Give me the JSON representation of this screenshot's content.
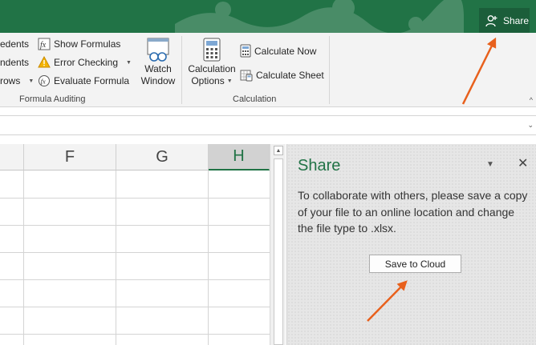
{
  "titlebar": {
    "share_label": "Share"
  },
  "ribbon": {
    "formula_auditing": {
      "trace_precedents": "edents",
      "trace_dependents": "ndents",
      "remove_arrows": "rows",
      "show_formulas": "Show Formulas",
      "error_checking": "Error Checking",
      "evaluate_formula": "Evaluate Formula",
      "watch_window_line1": "Watch",
      "watch_window_line2": "Window",
      "group_label": "Formula Auditing"
    },
    "calculation": {
      "options_line1": "Calculation",
      "options_line2": "Options",
      "calculate_now": "Calculate Now",
      "calculate_sheet": "Calculate Sheet",
      "group_label": "Calculation"
    }
  },
  "grid": {
    "columns": [
      "F",
      "G",
      "H"
    ],
    "active_column": "H"
  },
  "share_pane": {
    "title": "Share",
    "message": "To collaborate with others, please save a copy of your file to an online location and change the file type to .xlsx.",
    "button_label": "Save to Cloud",
    "accent_color": "#217346"
  },
  "colors": {
    "excel_green": "#217346",
    "annotation_arrow": "#e8601c"
  }
}
